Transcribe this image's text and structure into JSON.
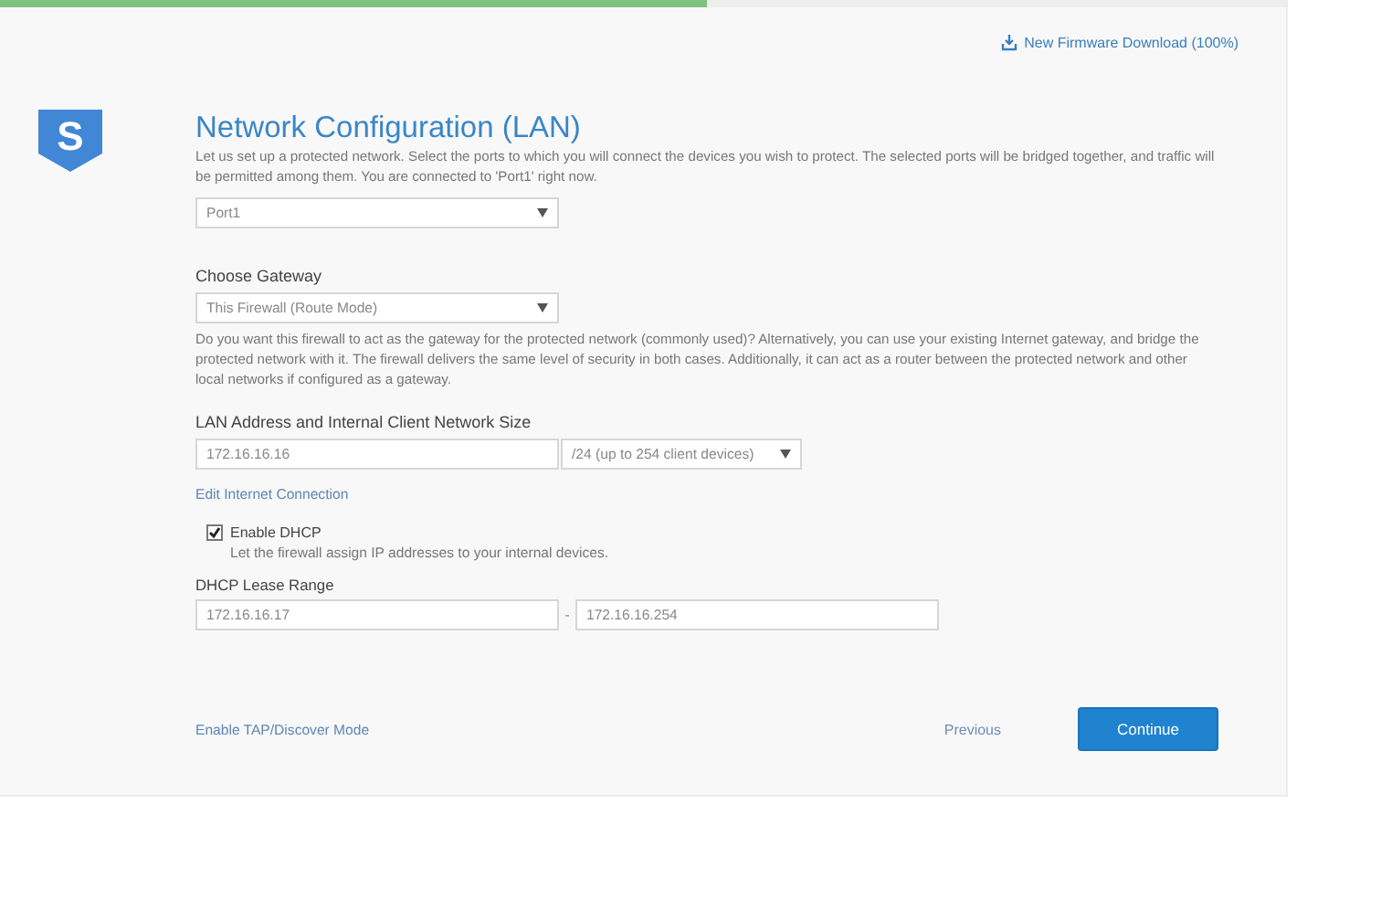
{
  "progress": {
    "level": 0.55
  },
  "firmware_link": "New Firmware Download (100%)",
  "logo": {
    "letter": "S"
  },
  "title": "Network Configuration (LAN)",
  "description": "Let us set up a protected network. Select the ports to which you will connect the devices you wish to protect. The selected ports will be bridged together, and traffic will be permitted among them. You are connected to 'Port1' right now.",
  "port_select": {
    "value": "Port1"
  },
  "gateway": {
    "label": "Choose Gateway",
    "value": "This Firewall (Route Mode)",
    "help": "Do you want this firewall to act as the gateway for the protected network (commonly used)? Alternatively, you can use your existing Internet gateway, and bridge the protected network with it. The firewall delivers the same level of security in both cases. Additionally, it can act as a router between the protected network and other local networks if configured as a gateway."
  },
  "lan": {
    "label": "LAN Address and Internal Client Network Size",
    "address": "172.16.16.16",
    "size": "/24 (up to 254 client devices)"
  },
  "edit_link": "Edit Internet Connection",
  "dhcp": {
    "label": "Enable DHCP",
    "checked": true,
    "help": "Let the firewall assign IP addresses to your internal devices."
  },
  "lease": {
    "label": "DHCP Lease Range",
    "start": "172.16.16.17",
    "separator": "-",
    "end": "172.16.16.254"
  },
  "tap_link": "Enable TAP/Discover Mode",
  "buttons": {
    "previous": "Previous",
    "continue": "Continue"
  }
}
